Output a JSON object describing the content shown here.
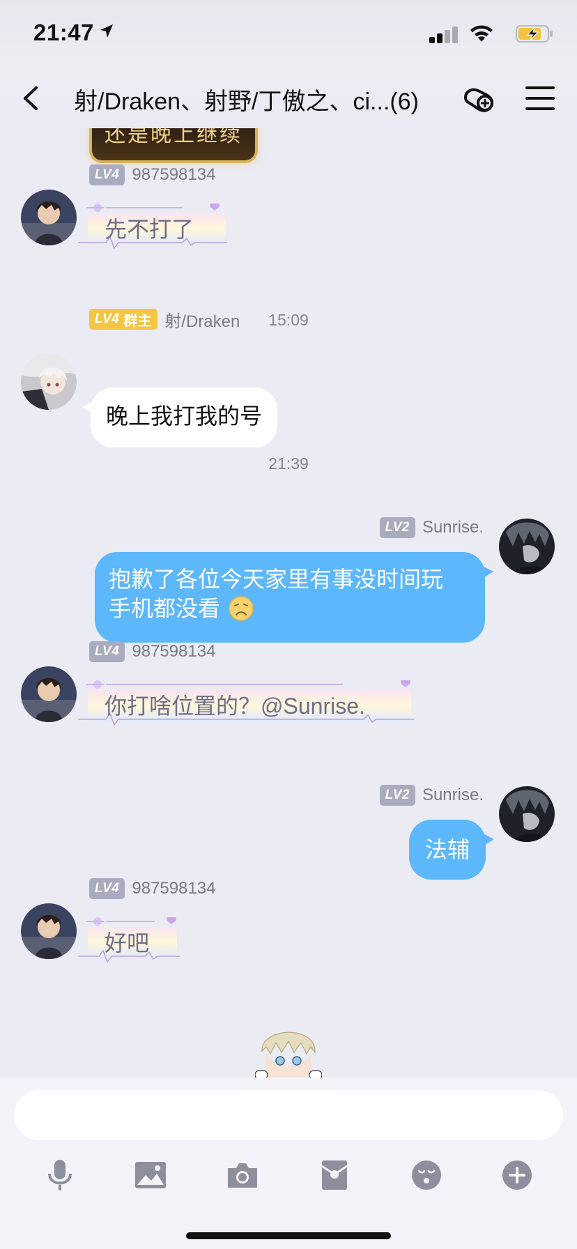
{
  "status_bar": {
    "time": "21:47"
  },
  "header": {
    "title": "射/Draken、射野/丁傲之、ci...(6)"
  },
  "messages": {
    "top_sticker_text": "还是晚上继续",
    "m1": {
      "level": "LV4",
      "sender": "987598134",
      "text": "先不打了"
    },
    "time1": "15:09",
    "m2": {
      "level": "LV4",
      "role": "群主",
      "sender": "射/Draken",
      "text": "晚上我打我的号"
    },
    "time2": "21:39",
    "m3": {
      "level": "LV2",
      "sender": "Sunrise.",
      "line1": "抱歉了各位今天家里有事没时间玩",
      "line2": "手机都没看"
    },
    "m4": {
      "level": "LV4",
      "sender": "987598134",
      "text": "你打啥位置的？",
      "mention": "@Sunrise."
    },
    "m5": {
      "level": "LV2",
      "sender": "Sunrise.",
      "text": "法辅"
    },
    "m6": {
      "level": "LV4",
      "sender": "987598134",
      "text": "好吧"
    }
  },
  "input": {
    "value": "",
    "placeholder": ""
  },
  "toolbar": [
    "microphone-icon",
    "image-icon",
    "camera-icon",
    "red-packet-icon",
    "emoji-icon",
    "plus-icon"
  ],
  "colors": {
    "blue_bubble": "#5cb7fb",
    "background": "#ebebf3",
    "gold_badge": "#f4c542",
    "level_badge": "#a9abbf"
  }
}
